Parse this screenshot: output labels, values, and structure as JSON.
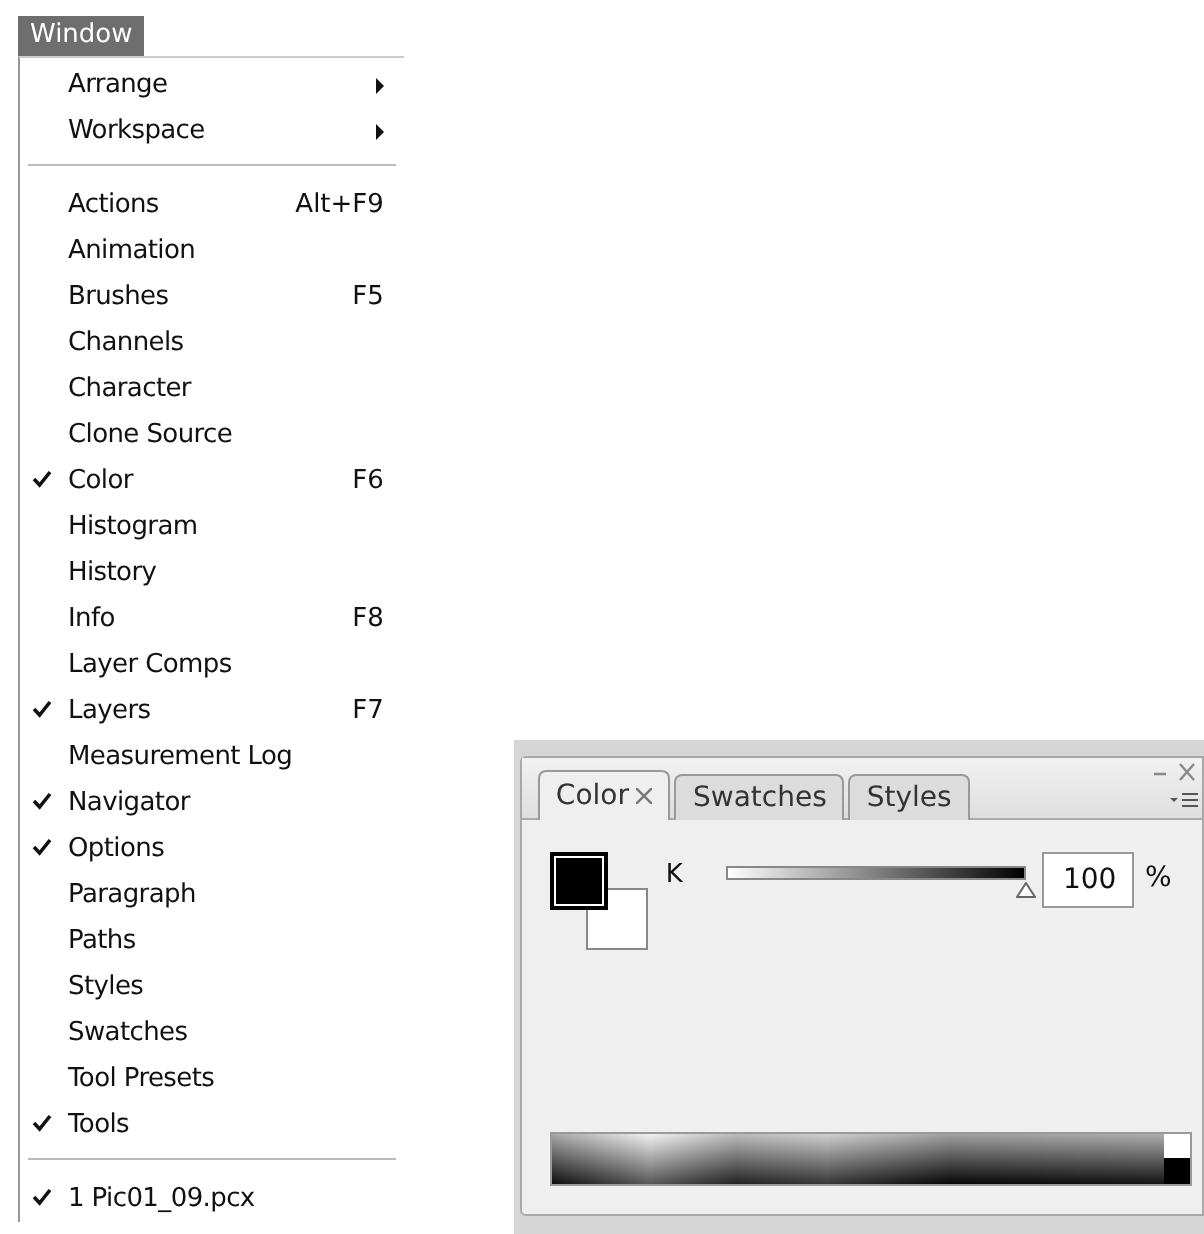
{
  "menu": {
    "title": "Window",
    "groups": [
      [
        {
          "label": "Arrange",
          "checked": false,
          "submenu": true
        },
        {
          "label": "Workspace",
          "checked": false,
          "submenu": true
        }
      ],
      [
        {
          "label": "Actions",
          "shortcut": "Alt+F9",
          "checked": false,
          "submenu": false
        },
        {
          "label": "Animation",
          "checked": false,
          "submenu": false
        },
        {
          "label": "Brushes",
          "shortcut": "F5",
          "checked": false,
          "submenu": false
        },
        {
          "label": "Channels",
          "checked": false,
          "submenu": false
        },
        {
          "label": "Character",
          "checked": false,
          "submenu": false
        },
        {
          "label": "Clone Source",
          "checked": false,
          "submenu": false
        },
        {
          "label": "Color",
          "shortcut": "F6",
          "checked": true,
          "submenu": false
        },
        {
          "label": "Histogram",
          "checked": false,
          "submenu": false
        },
        {
          "label": "History",
          "checked": false,
          "submenu": false
        },
        {
          "label": "Info",
          "shortcut": "F8",
          "checked": false,
          "submenu": false
        },
        {
          "label": "Layer Comps",
          "checked": false,
          "submenu": false
        },
        {
          "label": "Layers",
          "shortcut": "F7",
          "checked": true,
          "submenu": false
        },
        {
          "label": "Measurement Log",
          "checked": false,
          "submenu": false
        },
        {
          "label": "Navigator",
          "checked": true,
          "submenu": false
        },
        {
          "label": "Options",
          "checked": true,
          "submenu": false
        },
        {
          "label": "Paragraph",
          "checked": false,
          "submenu": false
        },
        {
          "label": "Paths",
          "checked": false,
          "submenu": false
        },
        {
          "label": "Styles",
          "checked": false,
          "submenu": false
        },
        {
          "label": "Swatches",
          "checked": false,
          "submenu": false
        },
        {
          "label": "Tool Presets",
          "checked": false,
          "submenu": false
        },
        {
          "label": "Tools",
          "checked": true,
          "submenu": false
        }
      ],
      [
        {
          "label": "1 Pic01_09.pcx",
          "checked": true,
          "submenu": false
        }
      ]
    ]
  },
  "panel": {
    "tabs": [
      {
        "label": "Color",
        "selected": true,
        "closable": true
      },
      {
        "label": "Swatches",
        "selected": false,
        "closable": false
      },
      {
        "label": "Styles",
        "selected": false,
        "closable": false
      }
    ],
    "channel": {
      "name": "K",
      "level": 1,
      "value": "100",
      "unit": "%"
    }
  }
}
